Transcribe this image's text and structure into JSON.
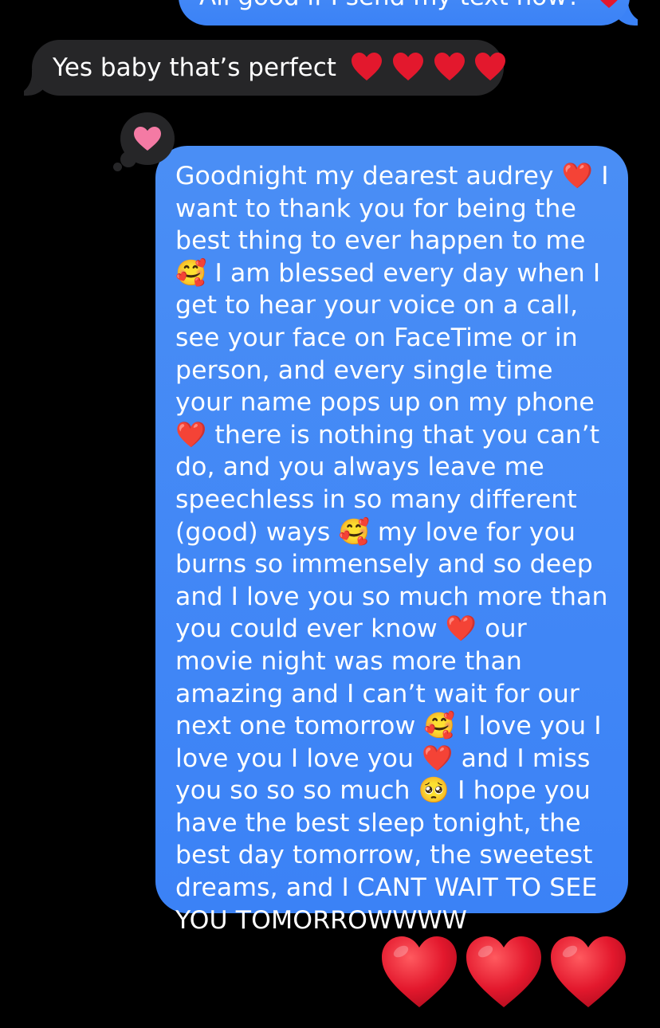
{
  "conversation": {
    "top_message": {
      "text": "All good if I send my text now?",
      "emoji_icon": "red-heart"
    },
    "incoming_message": {
      "text": "Yes baby that’s perfect",
      "emoji_icons": [
        "red-heart",
        "red-heart",
        "red-heart",
        "red-heart"
      ]
    },
    "tapback": {
      "icon": "pink-heart",
      "color": "#f47aa4"
    },
    "main_message": {
      "segments": [
        "Goodnight my dearest audrey ",
        "❤️",
        " I want to thank you for being the best thing to ever happen to me ",
        "🥰",
        " I am blessed every day when I get to hear your voice on a call, see your face on FaceTime or in person, and every single time your name pops up on my phone ",
        "❤️",
        " there is nothing that you can’t do, and you always leave me speechless in so many different (good) ways ",
        "🥰",
        " my love for you burns so immensely and so deep and I love you so much more than you could ever know ",
        "❤️",
        " our movie night was more than amazing and I can’t wait for our next one tomorrow ",
        "🥰",
        " I love you I love you I love you ",
        "❤️",
        " and I miss you so so so much ",
        "🥺",
        " I hope you have the best sleep tonight, the best day tomorrow, the sweetest dreams, and I CANT WAIT TO SEE YOU TOMORROWWWW"
      ]
    },
    "big_emoji_message": {
      "emoji_icons": [
        "red-heart",
        "red-heart",
        "red-heart"
      ]
    }
  },
  "colors": {
    "outgoing_bubble": "#3b82f6",
    "incoming_bubble": "#262628",
    "background": "#000000",
    "heart_red": "#e3182d"
  }
}
